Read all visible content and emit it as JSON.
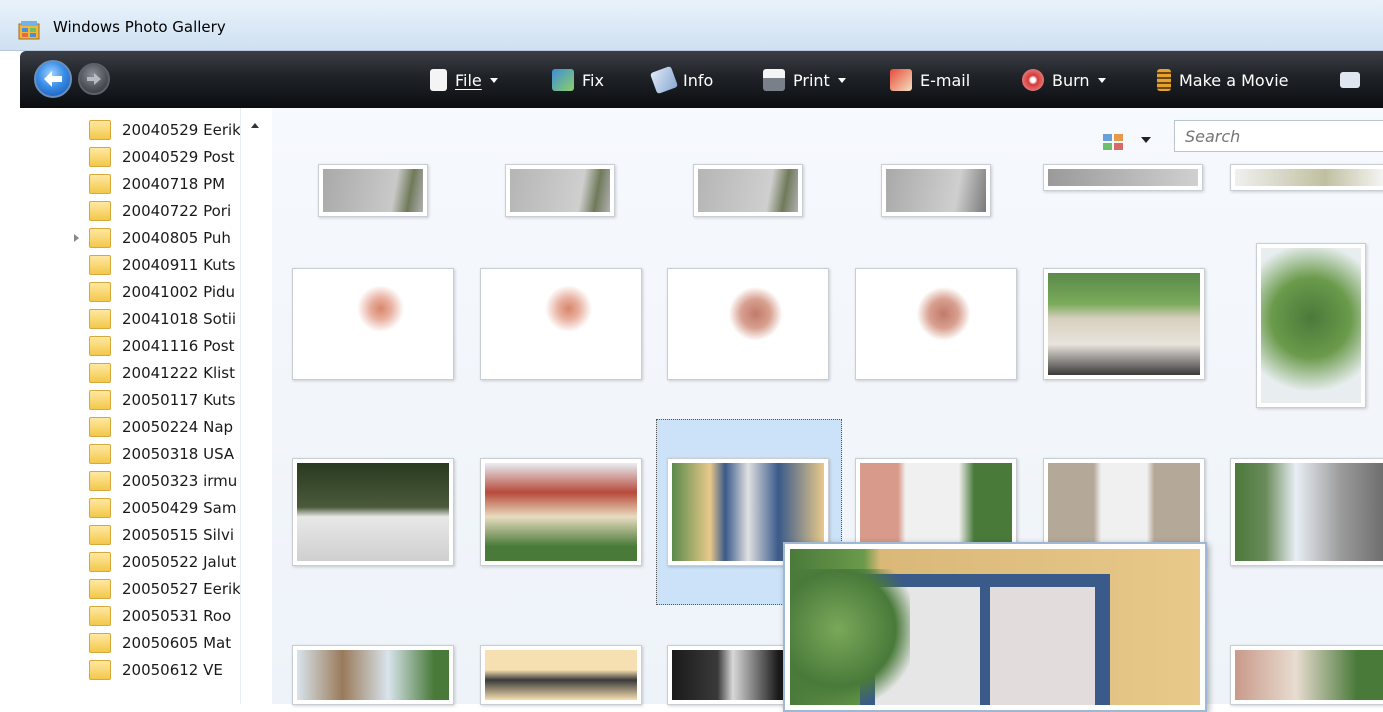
{
  "window": {
    "title": "Windows Photo Gallery"
  },
  "toolbar": {
    "file": "File",
    "fix": "Fix",
    "info": "Info",
    "print": "Print",
    "email": "E-mail",
    "burn": "Burn",
    "movie": "Make a Movie"
  },
  "search": {
    "placeholder": "Search"
  },
  "folders": [
    "20040529 Eerik",
    "20040529 Post",
    "20040718 PM",
    "20040722 Pori",
    "20040805 Puh",
    "20040911 Kuts",
    "20041002 Pidu",
    "20041018 Sotii",
    "20041116 Post",
    "20041222 Klist",
    "20050117 Kuts",
    "20050224 Nap",
    "20050318 USA",
    "20050323 irmu",
    "20050429 Sam",
    "20050515 Silvi",
    "20050522 Jalut",
    "20050527 Eerik",
    "20050531 Roo",
    "20050605 Mat",
    "20050612 VE"
  ],
  "colors": {
    "toolbar": "#1f2328",
    "selection": "#cbe2f8",
    "background": "#eef3f9"
  }
}
